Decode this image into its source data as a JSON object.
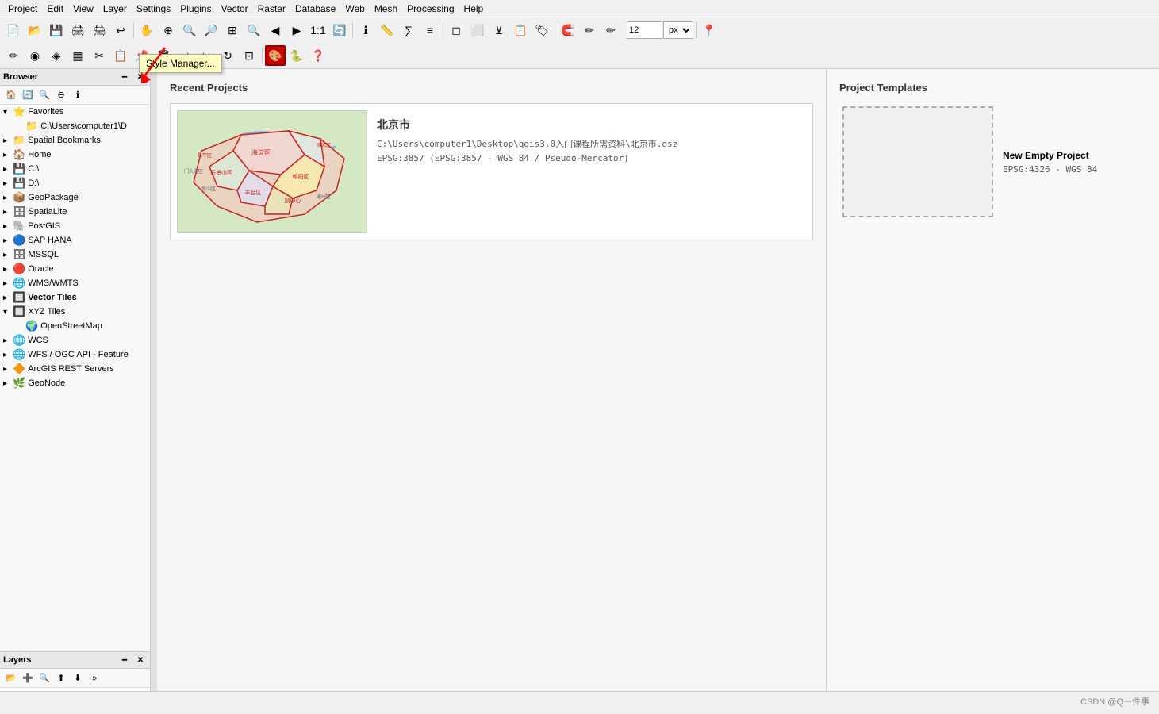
{
  "menubar": {
    "items": [
      "Project",
      "Edit",
      "View",
      "Layer",
      "Settings",
      "Plugins",
      "Vector",
      "Raster",
      "Database",
      "Web",
      "Mesh",
      "Processing",
      "Help"
    ]
  },
  "toolbar": {
    "style_manager_tooltip": "Style Manager...",
    "spinbox_value": "12",
    "select_value": "px"
  },
  "browser": {
    "title": "Browser",
    "tree": [
      {
        "level": 0,
        "icon": "⭐",
        "label": "Favorites",
        "expanded": true,
        "star": true
      },
      {
        "level": 1,
        "icon": "📁",
        "label": "C:\\Users\\computer1\\D",
        "expanded": false
      },
      {
        "level": 0,
        "icon": "📁",
        "label": "Spatial Bookmarks",
        "expanded": false
      },
      {
        "level": 0,
        "icon": "🏠",
        "label": "Home",
        "expanded": false
      },
      {
        "level": 0,
        "icon": "💾",
        "label": "C:\\",
        "expanded": false
      },
      {
        "level": 0,
        "icon": "💾",
        "label": "D:\\",
        "expanded": false
      },
      {
        "level": 0,
        "icon": "📦",
        "label": "GeoPackage",
        "expanded": false
      },
      {
        "level": 0,
        "icon": "🗄",
        "label": "SpatiaLite",
        "expanded": false
      },
      {
        "level": 0,
        "icon": "🐘",
        "label": "PostGIS",
        "expanded": false
      },
      {
        "level": 0,
        "icon": "🔵",
        "label": "SAP HANA",
        "expanded": false
      },
      {
        "level": 0,
        "icon": "🗄",
        "label": "MSSQL",
        "expanded": false
      },
      {
        "level": 0,
        "icon": "🔴",
        "label": "Oracle",
        "expanded": false
      },
      {
        "level": 0,
        "icon": "🌐",
        "label": "WMS/WMTS",
        "expanded": false
      },
      {
        "level": 0,
        "icon": "🔲",
        "label": "Vector Tiles",
        "expanded": false
      },
      {
        "level": 0,
        "icon": "🔲",
        "label": "XYZ Tiles",
        "expanded": true
      },
      {
        "level": 1,
        "icon": "🌍",
        "label": "OpenStreetMap",
        "expanded": false
      },
      {
        "level": 0,
        "icon": "🌐",
        "label": "WCS",
        "expanded": false
      },
      {
        "level": 0,
        "icon": "🌐",
        "label": "WFS / OGC API - Feature",
        "expanded": false
      },
      {
        "level": 0,
        "icon": "🔶",
        "label": "ArcGIS REST Servers",
        "expanded": false
      },
      {
        "level": 0,
        "icon": "🌿",
        "label": "GeoNode",
        "expanded": false
      }
    ]
  },
  "layers": {
    "title": "Layers"
  },
  "recent_projects": {
    "title": "Recent Projects",
    "items": [
      {
        "name": "北京市",
        "path": "C:\\Users\\computer1\\Desktop\\qgis3.0入门课程所需资料\\北京市.qsz",
        "epsg": "EPSG:3857 (EPSG:3857 - WGS 84 / Pseudo-Mercator)"
      }
    ]
  },
  "project_templates": {
    "title": "Project Templates",
    "items": [
      {
        "name": "New Empty Project",
        "crs": "EPSG:4326 - WGS 84"
      }
    ]
  },
  "watermark": "CSDN @Q一件事"
}
